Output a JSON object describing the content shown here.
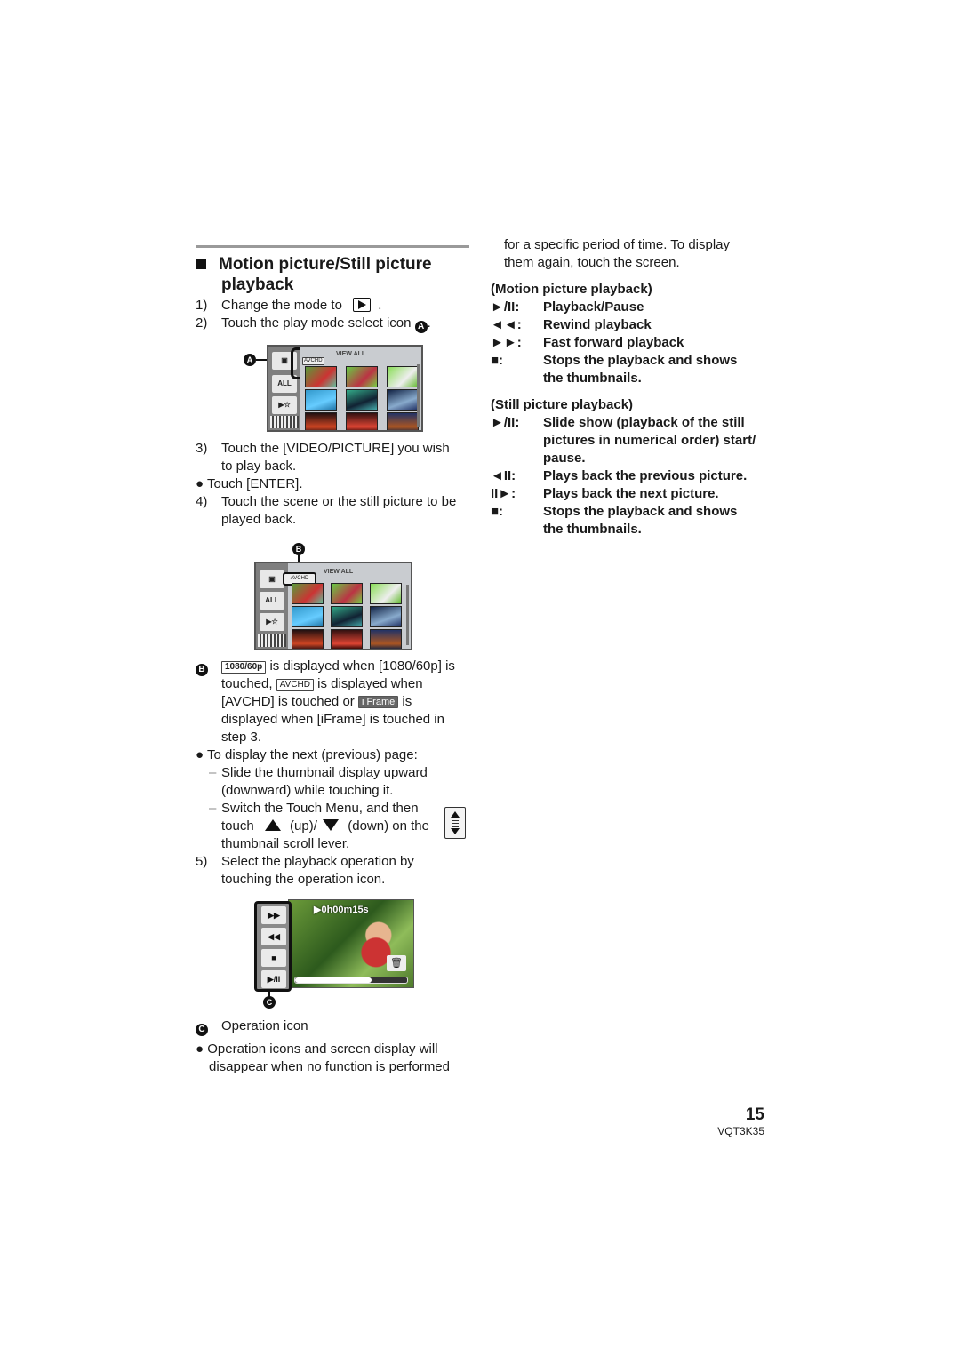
{
  "section": {
    "title_line1": "Motion picture/Still picture",
    "title_line2": "playback"
  },
  "steps": {
    "s1_num": "1)",
    "s1_text": "Change the mode to",
    "s1_end": ".",
    "s1_icon": "playback-mode-icon",
    "s2_num": "2)",
    "s2_text": "Touch the play mode select icon",
    "s2_end": ".",
    "callout_a": "A",
    "s3_num": "3)",
    "s3_line1": "Touch the [VIDEO/PICTURE] you wish",
    "s3_line2": "to play back.",
    "bullet_enter": "Touch [ENTER].",
    "s4_num": "4)",
    "s4_line1": "Touch the scene or the still picture to be",
    "s4_line2": "played back.",
    "s5_num": "5)",
    "s5_line1": "Select the playback operation by",
    "s5_line2": "touching the operation icon."
  },
  "screen1": {
    "view_all": "VIEW ALL",
    "all_button": "ALL",
    "format_tag": "AVCHD",
    "callout": "A"
  },
  "screen2": {
    "view_all": "VIEW ALL",
    "all_button": "ALL",
    "format_tag": "AVCHD",
    "callout": "B"
  },
  "note_b": {
    "callout": "B",
    "tag_1080": "1080/60p",
    "line1": "is displayed when [1080/60p] is",
    "line2a": "touched,",
    "tag_avchd": "AVCHD",
    "line2b": "is displayed when",
    "line3a": "[AVCHD] is touched or",
    "tag_iframe": "i Frame",
    "line3b": "is",
    "line4": "displayed when [iFrame] is touched in",
    "line5": "step 3."
  },
  "paging": {
    "bullet": "To display the next (previous) page:",
    "dash1_line1": "Slide the thumbnail display upward",
    "dash1_line2": "(downward) while touching it.",
    "dash2_line1": "Switch the Touch Menu, and then",
    "dash2_touch": "touch",
    "dash2_up": "(up)/",
    "dash2_down": "(down) on the",
    "dash2_line3": "thumbnail scroll lever."
  },
  "screen3": {
    "timecode": "0h00m15s",
    "buttons": [
      "▶▶",
      "◀◀",
      "■",
      "▶/II"
    ],
    "callout": "C",
    "progress": 0.68
  },
  "note_c": {
    "callout": "C",
    "label": "Operation icon",
    "bullet_line1": "Operation icons and screen display will",
    "bullet_line2": "disappear when no function is performed"
  },
  "right": {
    "cont_line1": "for a specific period of time. To display",
    "cont_line2": "them again, touch the screen.",
    "motion_heading": "(Motion picture playback)",
    "motion_items": [
      {
        "sym": "►/II:",
        "desc": "Playback/Pause"
      },
      {
        "sym": "◄◄:",
        "desc": "Rewind playback"
      },
      {
        "sym": "►►:",
        "desc": "Fast forward playback"
      },
      {
        "sym": "■:",
        "desc": "Stops the playback and shows",
        "desc2": "the thumbnails."
      }
    ],
    "still_heading": "(Still picture playback)",
    "still_items": [
      {
        "sym": "►/II:",
        "desc": "Slide show (playback of the still",
        "desc2": "pictures in numerical order) start/",
        "desc3": "pause."
      },
      {
        "sym": "◄II:",
        "desc": "Plays back the previous picture."
      },
      {
        "sym": "II►:",
        "desc": "Plays back the next picture."
      },
      {
        "sym": "■:",
        "desc": "Stops the playback and shows",
        "desc2": "the thumbnails."
      }
    ]
  },
  "footer": {
    "page_number": "15",
    "doc_code": "VQT3K35"
  }
}
